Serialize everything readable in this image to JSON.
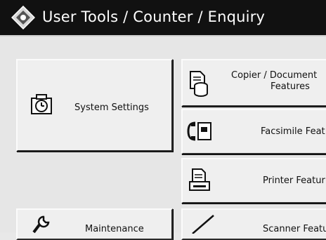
{
  "header": {
    "title": "User Tools / Counter / Enquiry",
    "icon": "diamond-tools-icon"
  },
  "buttons": {
    "system_settings": {
      "label": "System Settings",
      "icon": "clock-settings-icon"
    },
    "copier": {
      "label_line1": "Copier / Document",
      "label_line2": "Features",
      "icon": "copier-document-icon"
    },
    "facsimile": {
      "label": "Facsimile Feat",
      "icon": "facsimile-icon"
    },
    "printer": {
      "label": "Printer Featur",
      "icon": "printer-icon"
    },
    "maintenance": {
      "label": "Maintenance",
      "icon": "wrench-icon"
    },
    "scanner": {
      "label": "Scanner Featu",
      "icon": "scanner-icon"
    }
  }
}
